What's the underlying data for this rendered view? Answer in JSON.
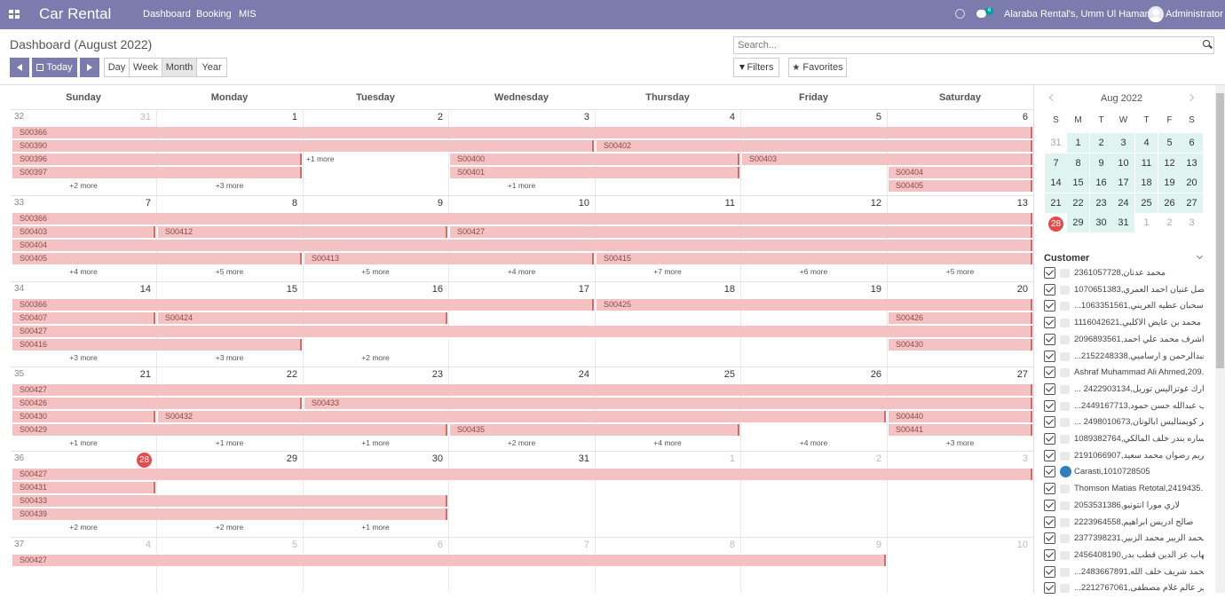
{
  "app": {
    "name": "Car Rental",
    "menu": [
      "Dashboard",
      "Booking",
      "MIS"
    ],
    "company": "Alaraba Rental's, Umm Ul Hamam",
    "user": "Administrator",
    "chat_count": "6",
    "accent": "#7c7bad"
  },
  "page": {
    "title": "Dashboard (August 2022)",
    "today_label": "Today",
    "views": [
      "Day",
      "Week",
      "Month",
      "Year"
    ],
    "active_view": "Month",
    "search_placeholder": "Search...",
    "filters_label": "Filters",
    "favorites_label": "Favorites"
  },
  "calendar": {
    "days": [
      "Sunday",
      "Monday",
      "Tuesday",
      "Wednesday",
      "Thursday",
      "Friday",
      "Saturday"
    ],
    "weeks": [
      {
        "num": "32",
        "dates": [
          "31",
          "1",
          "2",
          "3",
          "4",
          "5",
          "6"
        ],
        "muted": [
          0
        ],
        "today": -1,
        "events": [
          {
            "l": "S00366",
            "c": 0,
            "s": 7,
            "r": 0
          },
          {
            "l": "S00390",
            "c": 0,
            "s": 4,
            "r": 1
          },
          {
            "l": "S00402",
            "c": 4,
            "s": 3,
            "r": 1
          },
          {
            "l": "S00396",
            "c": 0,
            "s": 2,
            "r": 2
          },
          {
            "l": "S00400",
            "c": 3,
            "s": 2,
            "r": 2
          },
          {
            "l": "S00403",
            "c": 5,
            "s": 2,
            "r": 2
          },
          {
            "l": "S00397",
            "c": 0,
            "s": 2,
            "r": 3
          },
          {
            "l": "S00401",
            "c": 3,
            "s": 2,
            "r": 3
          },
          {
            "l": "S00404",
            "c": 6,
            "s": 1,
            "r": 3
          },
          {
            "l": "S00405",
            "c": 6,
            "s": 1,
            "r": 4
          }
        ],
        "more": [
          {
            "t": "+2 more",
            "c": 0,
            "r": 4
          },
          {
            "t": "+3 more",
            "c": 1,
            "r": 4
          },
          {
            "t": "+1 more",
            "c": 2,
            "r": 2
          },
          {
            "t": "+1 more",
            "c": 3,
            "r": 4
          }
        ]
      },
      {
        "num": "33",
        "dates": [
          "7",
          "8",
          "9",
          "10",
          "11",
          "12",
          "13"
        ],
        "muted": [],
        "today": -1,
        "events": [
          {
            "l": "S00366",
            "c": 0,
            "s": 7,
            "r": 0
          },
          {
            "l": "S00403",
            "c": 0,
            "s": 1,
            "r": 1
          },
          {
            "l": "S00412",
            "c": 1,
            "s": 2,
            "r": 1
          },
          {
            "l": "S00427",
            "c": 3,
            "s": 4,
            "r": 1
          },
          {
            "l": "S00404",
            "c": 0,
            "s": 7,
            "r": 2
          },
          {
            "l": "S00405",
            "c": 0,
            "s": 2,
            "r": 3
          },
          {
            "l": "S00413",
            "c": 2,
            "s": 2,
            "r": 3
          },
          {
            "l": "S00415",
            "c": 4,
            "s": 3,
            "r": 3
          }
        ],
        "more": [
          {
            "t": "+4 more",
            "c": 0,
            "r": 4
          },
          {
            "t": "+5 more",
            "c": 1,
            "r": 4
          },
          {
            "t": "+5 more",
            "c": 2,
            "r": 4
          },
          {
            "t": "+4 more",
            "c": 3,
            "r": 4
          },
          {
            "t": "+7 more",
            "c": 4,
            "r": 4
          },
          {
            "t": "+6 more",
            "c": 5,
            "r": 4
          },
          {
            "t": "+5 more",
            "c": 6,
            "r": 4
          }
        ]
      },
      {
        "num": "34",
        "dates": [
          "14",
          "15",
          "16",
          "17",
          "18",
          "19",
          "20"
        ],
        "muted": [],
        "today": -1,
        "events": [
          {
            "l": "S00366",
            "c": 0,
            "s": 4,
            "r": 0
          },
          {
            "l": "S00425",
            "c": 4,
            "s": 3,
            "r": 0
          },
          {
            "l": "S00407",
            "c": 0,
            "s": 1,
            "r": 1
          },
          {
            "l": "S00424",
            "c": 1,
            "s": 2,
            "r": 1
          },
          {
            "l": "S00426",
            "c": 6,
            "s": 1,
            "r": 1
          },
          {
            "l": "S00427",
            "c": 0,
            "s": 7,
            "r": 2
          },
          {
            "l": "S00416",
            "c": 0,
            "s": 2,
            "r": 3
          },
          {
            "l": "S00430",
            "c": 6,
            "s": 1,
            "r": 3
          }
        ],
        "more": [
          {
            "t": "+3 more",
            "c": 0,
            "r": 4
          },
          {
            "t": "+3 more",
            "c": 1,
            "r": 4
          },
          {
            "t": "+2 more",
            "c": 2,
            "r": 4
          }
        ]
      },
      {
        "num": "35",
        "dates": [
          "21",
          "22",
          "23",
          "24",
          "25",
          "26",
          "27"
        ],
        "muted": [],
        "today": -1,
        "events": [
          {
            "l": "S00427",
            "c": 0,
            "s": 7,
            "r": 0
          },
          {
            "l": "S00426",
            "c": 0,
            "s": 2,
            "r": 1
          },
          {
            "l": "S00433",
            "c": 2,
            "s": 5,
            "r": 1
          },
          {
            "l": "S00430",
            "c": 0,
            "s": 1,
            "r": 2
          },
          {
            "l": "S00432",
            "c": 1,
            "s": 5,
            "r": 2
          },
          {
            "l": "S00440",
            "c": 6,
            "s": 1,
            "r": 2
          },
          {
            "l": "S00429",
            "c": 0,
            "s": 3,
            "r": 3
          },
          {
            "l": "S00435",
            "c": 3,
            "s": 2,
            "r": 3
          },
          {
            "l": "S00441",
            "c": 6,
            "s": 1,
            "r": 3
          }
        ],
        "more": [
          {
            "t": "+1 more",
            "c": 0,
            "r": 4
          },
          {
            "t": "+1 more",
            "c": 1,
            "r": 4
          },
          {
            "t": "+1 more",
            "c": 2,
            "r": 4
          },
          {
            "t": "+2 more",
            "c": 3,
            "r": 4
          },
          {
            "t": "+4 more",
            "c": 4,
            "r": 4
          },
          {
            "t": "+4 more",
            "c": 5,
            "r": 4
          },
          {
            "t": "+3 more",
            "c": 6,
            "r": 4
          }
        ]
      },
      {
        "num": "36",
        "dates": [
          "28",
          "29",
          "30",
          "31",
          "1",
          "2",
          "3"
        ],
        "muted": [
          4,
          5,
          6
        ],
        "today": 0,
        "events": [
          {
            "l": "S00427",
            "c": 0,
            "s": 7,
            "r": 0
          },
          {
            "l": "S00431",
            "c": 0,
            "s": 1,
            "r": 1
          },
          {
            "l": "S00433",
            "c": 0,
            "s": 3,
            "r": 2
          },
          {
            "l": "S00439",
            "c": 0,
            "s": 3,
            "r": 3
          }
        ],
        "more": [
          {
            "t": "+2 more",
            "c": 0,
            "r": 4
          },
          {
            "t": "+2 more",
            "c": 1,
            "r": 4
          },
          {
            "t": "+1 more",
            "c": 2,
            "r": 4
          }
        ]
      },
      {
        "num": "37",
        "dates": [
          "4",
          "5",
          "6",
          "7",
          "8",
          "9",
          "10"
        ],
        "muted": [
          0,
          1,
          2,
          3,
          4,
          5,
          6
        ],
        "today": -1,
        "events": [
          {
            "l": "S00427",
            "c": 0,
            "s": 6,
            "r": 0
          }
        ],
        "more": []
      }
    ]
  },
  "mini": {
    "month": "Aug 2022",
    "dow": [
      "S",
      "M",
      "T",
      "W",
      "T",
      "F",
      "S"
    ],
    "rows": [
      [
        "31",
        "1",
        "2",
        "3",
        "4",
        "5",
        "6"
      ],
      [
        "7",
        "8",
        "9",
        "10",
        "11",
        "12",
        "13"
      ],
      [
        "14",
        "15",
        "16",
        "17",
        "18",
        "19",
        "20"
      ],
      [
        "21",
        "22",
        "23",
        "24",
        "25",
        "26",
        "27"
      ],
      [
        "28",
        "29",
        "30",
        "31",
        "1",
        "2",
        "3"
      ]
    ]
  },
  "customers": {
    "title": "Customer",
    "items": [
      "محمد عدنان,2361057728",
      "فيصل غنيان احمد العمري,1070651383",
      "...ل سحبان عطيه العريني,1063351561",
      "محمد بن عايض الاكلبي,1116042621",
      "اشرف محمد علي احمد,2096893561",
      "...ب عبدالرحمن و ارساميي,2152248338",
      "Ashraf Muhammad Ali Ahmed,209...",
      "... مارك غوتزاليس توريل,2422903134",
      "...يب عبدالله حسن حمود,2449167713",
      "... جر كويمناليس ابالونان,2498010673",
      "ساره بندر خلف المالكي,1089382764",
      "مريم رضوان محمد سعيد,2191066907",
      "Carasti,1010728505",
      "Thomson Matias Retotal,2419435...",
      "لاري مورا انتونيو,2053531386",
      "صالح ادريس ابراهيم,2223964558",
      "محمد الزبير محمد الزبير,2377398231",
      "ايهاب عز الدين قطب بدر,2456408190",
      "...د محمد شريف خلف الله,2483667891",
      "...نجير عالم غلام مصطفى,2212767061"
    ]
  }
}
